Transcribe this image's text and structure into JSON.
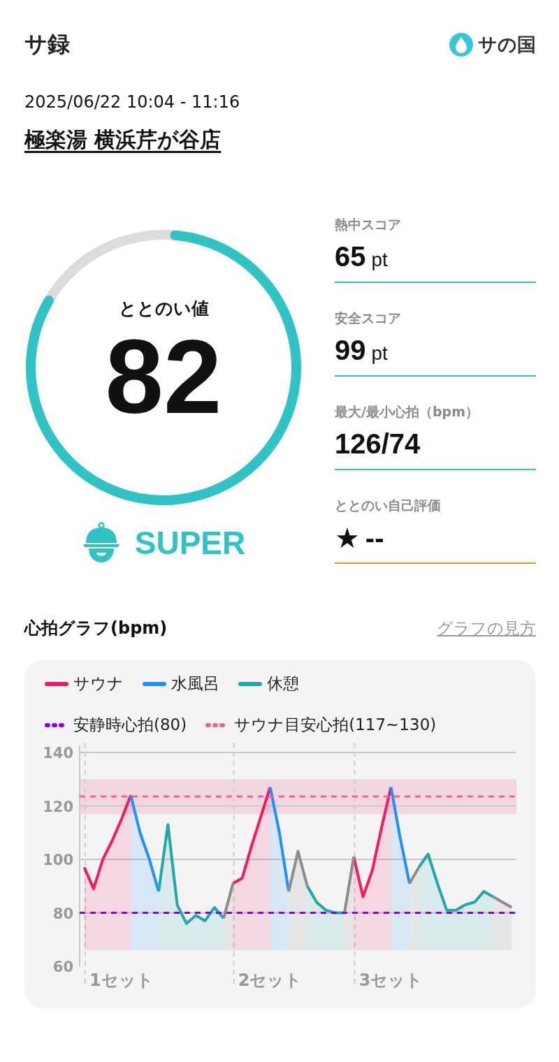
{
  "header": {
    "title": "サ録",
    "logo_text": "サの国"
  },
  "session": {
    "datetime": "2025/06/22 10:04 - 11:16",
    "venue": "極楽湯 横浜芹が谷店"
  },
  "score": {
    "label": "ととのい値",
    "value": "82",
    "level": 0.82,
    "rank": "SUPER"
  },
  "stats": [
    {
      "kind": "score",
      "label": "熱中スコア",
      "value": "65",
      "unit": "pt",
      "color": "#2ec4c6"
    },
    {
      "kind": "score",
      "label": "安全スコア",
      "value": "99",
      "unit": "pt",
      "color": "#2ec4c6"
    },
    {
      "kind": "plain",
      "label": "最大/最小心拍（bpm）",
      "value": "126/74",
      "color": "#2ec4c6"
    },
    {
      "kind": "rating",
      "label": "ととのい自己評価",
      "symbol": "★",
      "value": "--",
      "color": "#f0932b"
    }
  ],
  "graph": {
    "title": "心拍グラフ(bpm)",
    "link": "グラフの見方",
    "chart_data": {
      "type": "area",
      "grid": true,
      "legend": "top",
      "categories": [
        null,
        null,
        null,
        null,
        "1セット",
        null,
        null,
        null,
        null,
        null,
        null,
        null,
        null,
        null,
        null,
        null,
        null,
        null,
        null,
        null,
        "2セット",
        null,
        null,
        null,
        null,
        null,
        null,
        null,
        null,
        null,
        null,
        null,
        null,
        "3セット",
        null,
        null,
        null,
        null,
        null,
        null,
        null,
        null,
        null,
        null,
        null,
        null,
        null
      ],
      "series": [
        {
          "name": "サウナ",
          "color": "#f5195f",
          "values": [
            97,
            89,
            100,
            107,
            115,
            124,
            null,
            null,
            null,
            null,
            null,
            null,
            null,
            null,
            null,
            null,
            91,
            93,
            105,
            116,
            127,
            null,
            null,
            null,
            null,
            null,
            null,
            null,
            null,
            101,
            86,
            96,
            112,
            127,
            null,
            null,
            null,
            null,
            null,
            null,
            null,
            null,
            null,
            null,
            null,
            null,
            null
          ]
        },
        {
          "name": "水風呂",
          "color": "#1e90ff",
          "values": [
            null,
            null,
            null,
            null,
            null,
            124,
            110,
            100,
            88,
            null,
            null,
            null,
            null,
            null,
            null,
            null,
            null,
            null,
            null,
            null,
            127,
            110,
            88,
            null,
            null,
            null,
            null,
            null,
            null,
            null,
            null,
            null,
            null,
            127,
            108,
            91,
            null,
            null,
            null,
            null,
            null,
            null,
            null,
            null,
            null,
            null,
            null
          ]
        },
        {
          "name": "休憩",
          "color": "#20a8a8",
          "values": [
            null,
            null,
            null,
            null,
            null,
            null,
            null,
            null,
            88,
            113,
            83,
            76,
            79,
            77,
            82,
            78,
            null,
            null,
            null,
            null,
            null,
            null,
            null,
            null,
            90,
            84,
            81,
            80,
            80,
            null,
            null,
            null,
            null,
            null,
            null,
            null,
            97,
            102,
            91,
            81,
            81,
            83,
            84,
            88,
            86,
            null,
            null
          ]
        },
        {
          "color": "#8c8c8c",
          "values": [
            null,
            null,
            null,
            null,
            null,
            null,
            null,
            null,
            null,
            null,
            null,
            null,
            null,
            null,
            null,
            78,
            91,
            null,
            null,
            null,
            null,
            null,
            88,
            103,
            90,
            null,
            null,
            null,
            80,
            101,
            null,
            null,
            null,
            null,
            null,
            91,
            97,
            null,
            null,
            null,
            null,
            null,
            null,
            null,
            86,
            84,
            82
          ]
        }
      ],
      "ylim": [
        60,
        140
      ],
      "yticks": [
        60,
        80,
        100,
        120,
        140
      ],
      "ref_lines": [
        {
          "axis": "y",
          "value": 80,
          "label": "安静時心拍(80)",
          "color": "#8a00ff"
        },
        {
          "axis": "y",
          "value": 123.5,
          "color": "#f06292"
        }
      ],
      "bands": [
        {
          "axis": "y",
          "from": 117,
          "to": 130,
          "label": "サウナ目安心拍(117~130)",
          "color": "#f06292"
        }
      ]
    }
  }
}
